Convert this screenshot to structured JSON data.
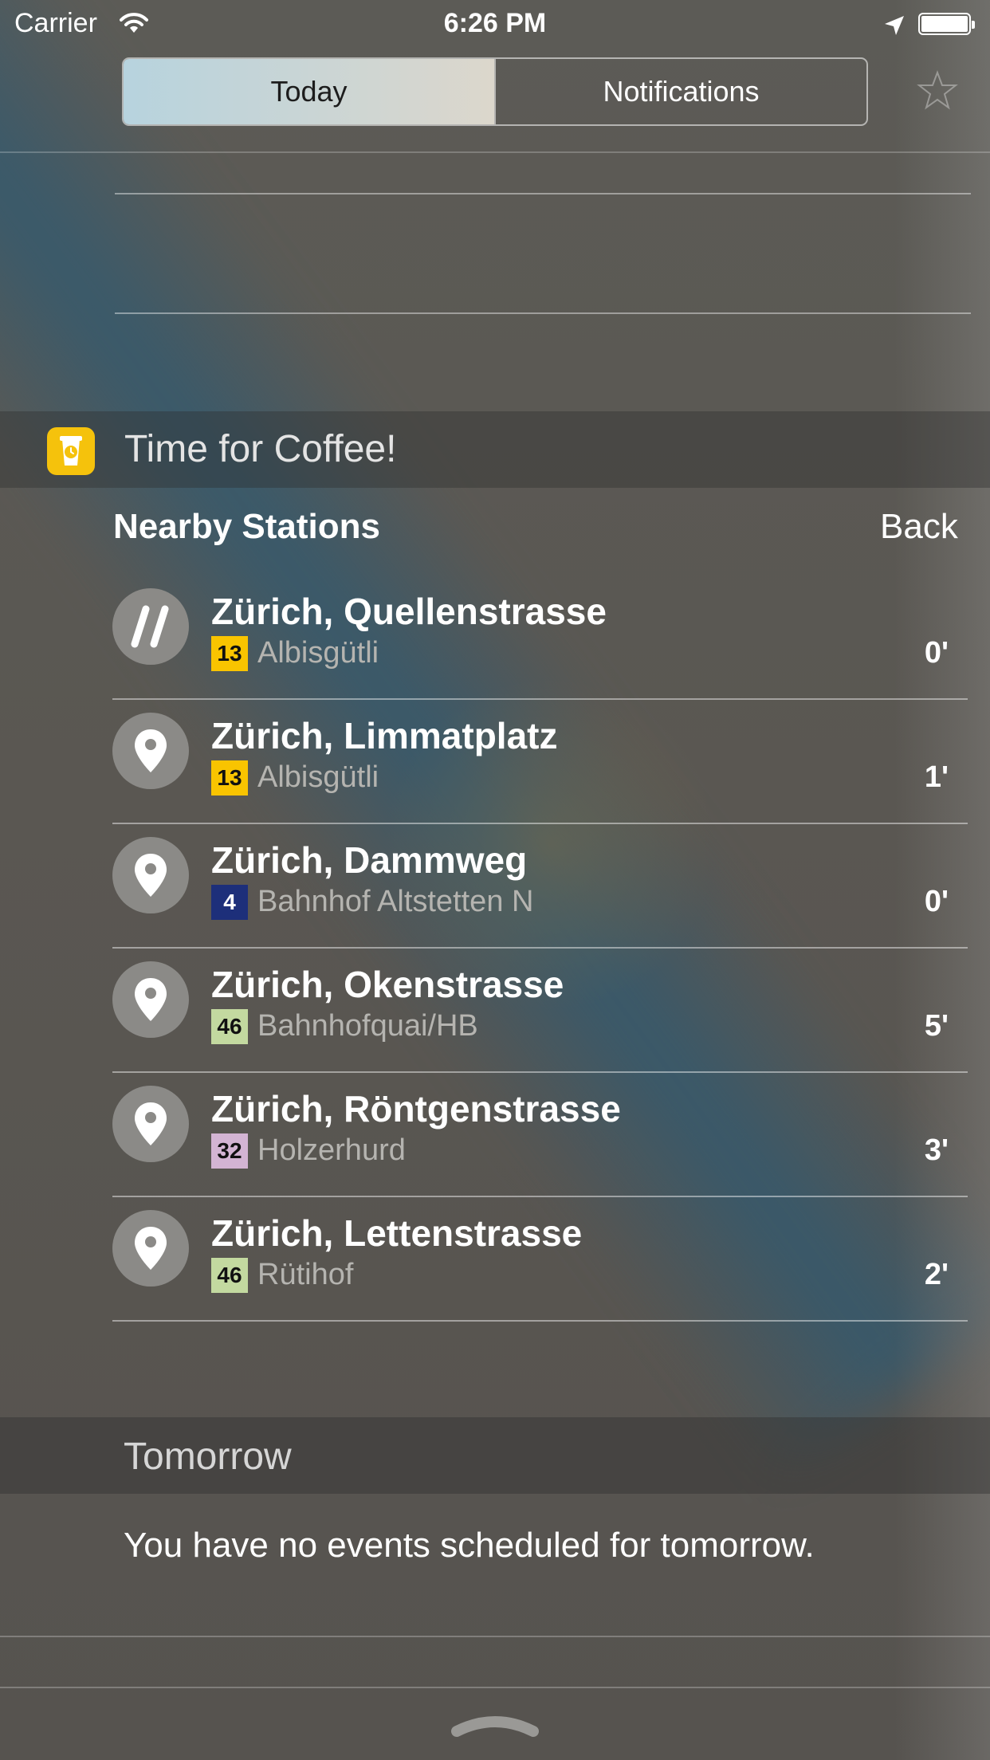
{
  "status_bar": {
    "carrier": "Carrier",
    "time": "6:26 PM"
  },
  "segmented": {
    "tabs": [
      {
        "label": "Today",
        "active": true
      },
      {
        "label": "Notifications",
        "active": false
      }
    ]
  },
  "widget": {
    "app_name": "Time for Coffee!",
    "app_icon": "coffee-cup-clock-icon",
    "accent_color": "#f5c20c",
    "section_title": "Nearby Stations",
    "back_label": "Back",
    "stations": [
      {
        "name": "Zürich, Quellenstrasse",
        "line": "13",
        "line_bg": "#f9c400",
        "line_fg": "#111111",
        "destination": "Albisgütli",
        "minutes": "0'",
        "icon": "favorite-slashes-icon"
      },
      {
        "name": "Zürich, Limmatplatz",
        "line": "13",
        "line_bg": "#f9c400",
        "line_fg": "#111111",
        "destination": "Albisgütli",
        "minutes": "1'",
        "icon": "location-pin-icon"
      },
      {
        "name": "Zürich, Dammweg",
        "line": "4",
        "line_bg": "#1d2f7a",
        "line_fg": "#ffffff",
        "destination": "Bahnhof Altstetten N",
        "minutes": "0'",
        "icon": "location-pin-icon"
      },
      {
        "name": "Zürich, Okenstrasse",
        "line": "46",
        "line_bg": "#c3d9a0",
        "line_fg": "#111111",
        "destination": "Bahnhofquai/HB",
        "minutes": "5'",
        "icon": "location-pin-icon"
      },
      {
        "name": "Zürich, Röntgenstrasse",
        "line": "32",
        "line_bg": "#d3b4d3",
        "line_fg": "#111111",
        "destination": "Holzerhurd",
        "minutes": "3'",
        "icon": "location-pin-icon"
      },
      {
        "name": "Zürich, Lettenstrasse",
        "line": "46",
        "line_bg": "#c3d9a0",
        "line_fg": "#111111",
        "destination": "Rütihof",
        "minutes": "2'",
        "icon": "location-pin-icon"
      }
    ]
  },
  "tomorrow": {
    "title": "Tomorrow",
    "message": "You have no events scheduled for tomorrow."
  }
}
